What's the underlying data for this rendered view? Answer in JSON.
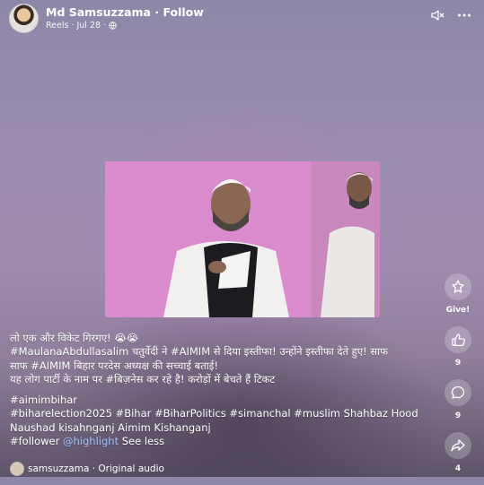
{
  "post": {
    "author": "Md Samsuzzama",
    "follow_label": "Follow",
    "type_label": "Reels",
    "date": "Jul 28"
  },
  "actions": {
    "give_label": "Give!",
    "like_count": "9",
    "comment_count": "9",
    "share_count": "4"
  },
  "caption": {
    "line1_text": "लो एक और विकेट गिरगए! ",
    "line1_emoji": "😭😭",
    "line2": "#MaulanaAbdullasalim चतुर्वेदी ने #AIMIM से दिया इस्तीफा! उन्होंने इस्तीफा देते हुए! साफ",
    "line3": "साफ #AIMIM बिहार परदेस अध्यक्ष की सच्चाई बताई!",
    "line4": " यह लोग पार्टी के नाम पर #बिज़नेस कर रहे है! करोड़ों  में बेचते हैं टिकट",
    "line5": "#aimimbihar",
    "line6": "#biharelection2025 #Bihar #BiharPolitics #simanchal #muslim Shahbaz Hood",
    "line7": "Naushad kisahnganj Aimim Kishanganj",
    "line8_text": "#follower ",
    "line8_mention": "@highlight",
    "see_less": "See less"
  },
  "audio": {
    "label": "samsuzzama · Original audio"
  }
}
